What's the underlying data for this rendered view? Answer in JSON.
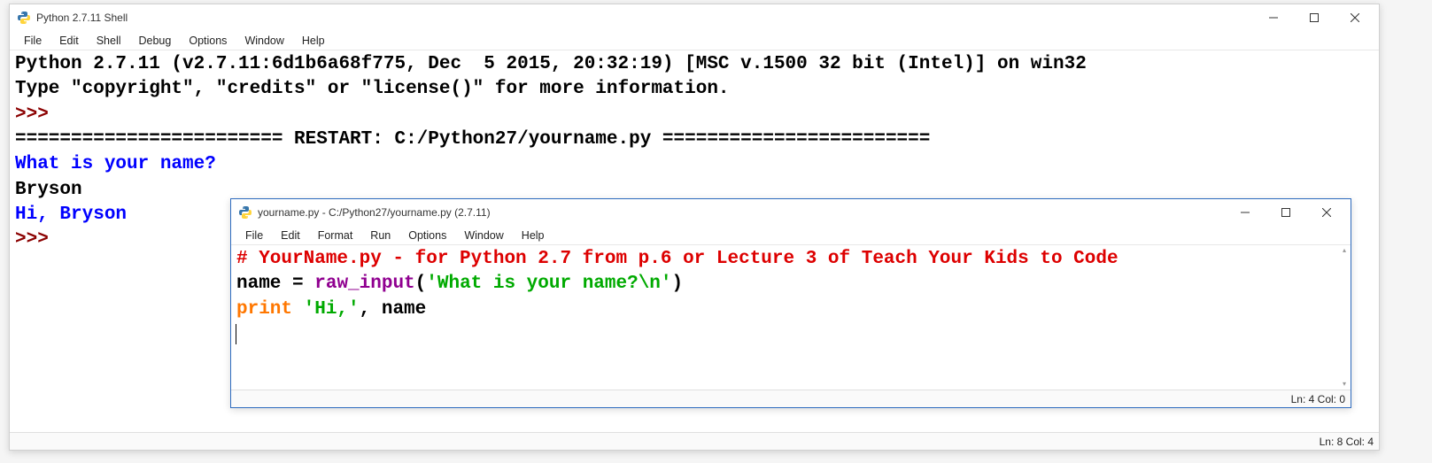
{
  "shell": {
    "title": "Python 2.7.11 Shell",
    "menus": [
      "File",
      "Edit",
      "Shell",
      "Debug",
      "Options",
      "Window",
      "Help"
    ],
    "lines": {
      "l1": "Python 2.7.11 (v2.7.11:6d1b6a68f775, Dec  5 2015, 20:32:19) [MSC v.1500 32 bit (Intel)] on win32",
      "l2": "Type \"copyright\", \"credits\" or \"license()\" for more information.",
      "prompt1": ">>> ",
      "restart": "======================== RESTART: C:/Python27/yourname.py ========================",
      "ask": "What is your name?",
      "input": "Bryson",
      "greet": "Hi, Bryson",
      "prompt2": ">>> "
    },
    "status": "Ln: 8  Col: 4"
  },
  "editor": {
    "title": "yourname.py - C:/Python27/yourname.py (2.7.11)",
    "menus": [
      "File",
      "Edit",
      "Format",
      "Run",
      "Options",
      "Window",
      "Help"
    ],
    "code": {
      "comment": "# YourName.py - for Python 2.7 from p.6 or Lecture 3 of Teach Your Kids to Code",
      "name_var": "name ",
      "eq": "= ",
      "raw_input": "raw_input",
      "lparen": "(",
      "str": "'What is your name?\\n'",
      "rparen": ")",
      "print_kw": "print",
      "space": " ",
      "hi_str": "'Hi,'",
      "comma_name": ", name"
    },
    "status": "Ln: 4  Col: 0"
  }
}
